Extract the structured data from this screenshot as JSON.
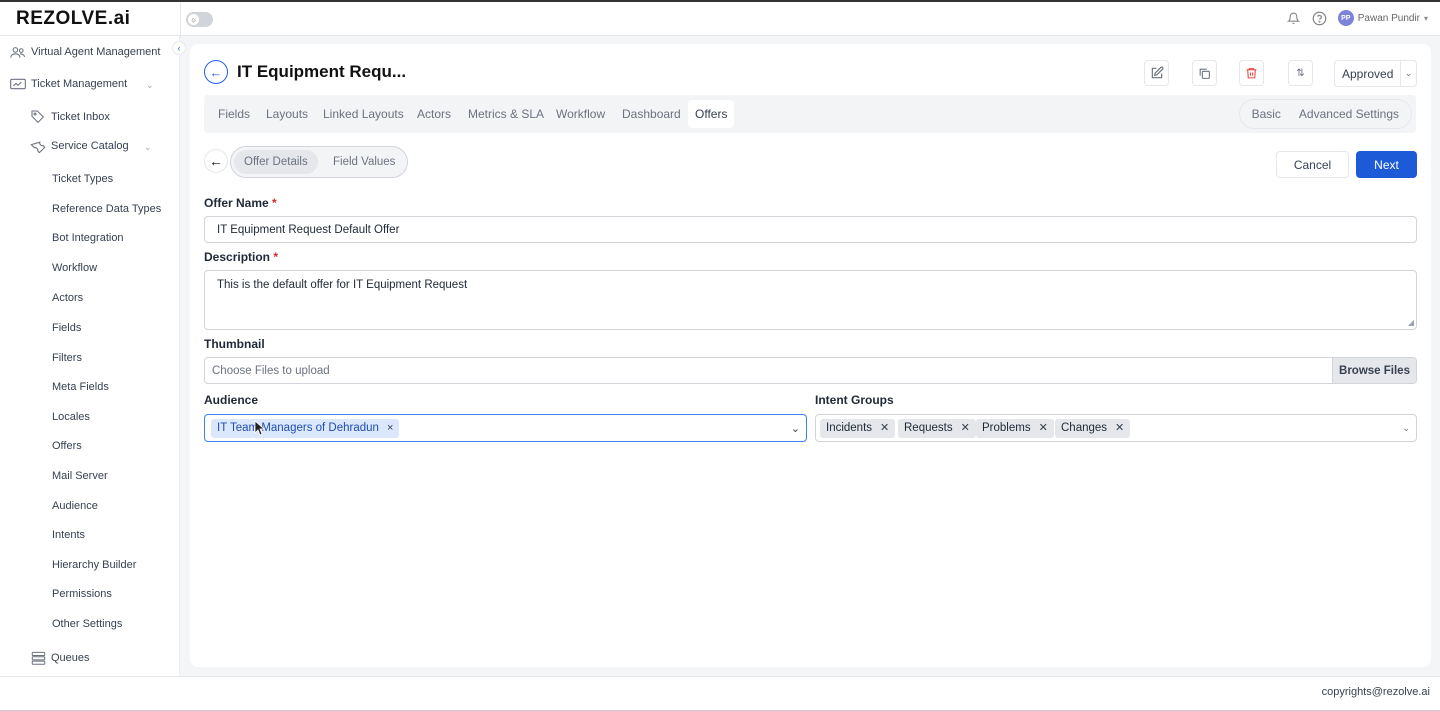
{
  "app": {
    "logo": "REZOLVE.ai"
  },
  "topbar": {
    "user_initials": "PP",
    "user_name": "Pawan Pundir",
    "icons": [
      "bell-icon",
      "help-icon",
      "chevron-down-icon"
    ]
  },
  "sidebar": {
    "items": [
      {
        "label": "Virtual Agent Management",
        "icon": "users-icon"
      },
      {
        "label": "Ticket Management",
        "icon": "ticket-icon"
      },
      {
        "label": "Ticket Inbox",
        "icon": "tag-icon"
      },
      {
        "label": "Service Catalog",
        "icon": "wrench-icon"
      },
      {
        "label": "Ticket Types"
      },
      {
        "label": "Reference Data Types"
      },
      {
        "label": "Bot Integration"
      },
      {
        "label": "Workflow"
      },
      {
        "label": "Actors"
      },
      {
        "label": "Fields"
      },
      {
        "label": "Filters"
      },
      {
        "label": "Meta Fields"
      },
      {
        "label": "Locales"
      },
      {
        "label": "Offers"
      },
      {
        "label": "Mail Server"
      },
      {
        "label": "Audience"
      },
      {
        "label": "Intents"
      },
      {
        "label": "Hierarchy Builder"
      },
      {
        "label": "Permissions"
      },
      {
        "label": "Other Settings"
      },
      {
        "label": "Queues",
        "icon": "list-icon"
      }
    ]
  },
  "page": {
    "title": "IT Equipment Requ...",
    "status": "Approved",
    "tabs": [
      "Fields",
      "Layouts",
      "Linked Layouts",
      "Actors",
      "Metrics & SLA",
      "Workflow",
      "Dashboard",
      "Offers"
    ],
    "active_tab": "Offers",
    "modes": [
      "Basic",
      "Advanced Settings"
    ]
  },
  "offer": {
    "subtabs": [
      "Offer Details",
      "Field Values"
    ],
    "cancel_label": "Cancel",
    "next_label": "Next",
    "offer_name_label": "Offer Name",
    "offer_name_value": "IT Equipment Request Default Offer",
    "description_label": "Description",
    "description_value": "This is the default offer for IT Equipment Request",
    "thumbnail_label": "Thumbnail",
    "thumbnail_placeholder": "Choose Files to upload",
    "browse_label": "Browse Files",
    "audience_label": "Audience",
    "audience_values": [
      "IT Team Managers of Dehradun"
    ],
    "intent_groups_label": "Intent Groups",
    "intent_groups_values": [
      "Incidents",
      "Requests",
      "Problems",
      "Changes"
    ],
    "required_mark": "*"
  },
  "footer": {
    "copyright": "copyrights@rezolve.ai"
  },
  "colors": {
    "primary": "#1d5ad8",
    "delete": "#ef4444",
    "chip_blue": "#dbe7fb"
  }
}
